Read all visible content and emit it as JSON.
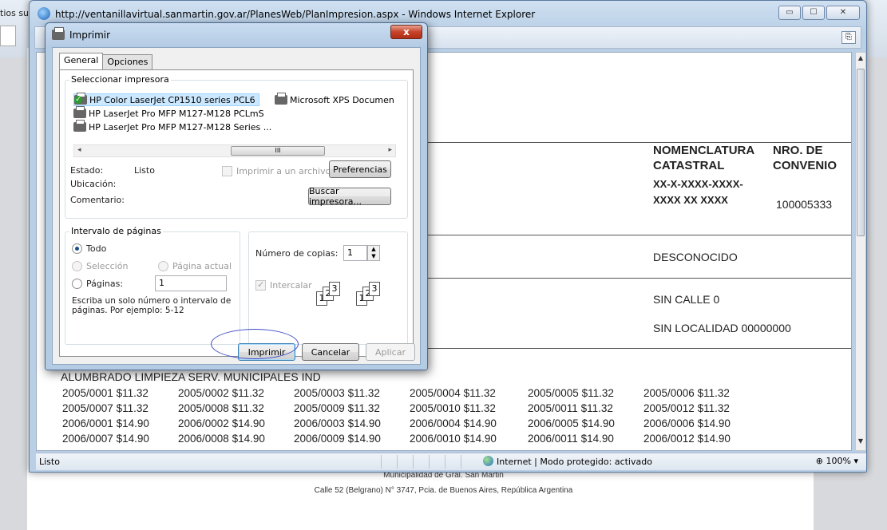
{
  "background": {
    "tab_fragment": "tios su",
    "footer_municipality": "Municipalidad de Gral. San Martin",
    "footer_address": "Calle 52 (Belgrano) N° 3747, Pcia. de Buenos Aires, República Argentina"
  },
  "browser": {
    "title": "http://ventanillavirtual.sanmartin.gov.ar/PlanesWeb/PlanImpresion.aspx - Windows Internet Explorer",
    "status_left": "Listo",
    "status_zone": "Internet | Modo protegido: activado",
    "zoom": "100%"
  },
  "document": {
    "col1_header": "NOMENCLATURA\nCATASTRAL",
    "col2_header": "NRO. DE\nCONVENIO",
    "nomenclatura": "XX-X-XXXX-XXXX-\nXXXX XX XXXX",
    "convenio": "100005333",
    "owner": "DESCONOCIDO",
    "street": "SIN CALLE 0",
    "locality": "SIN LOCALIDAD 00000000",
    "tax_title": "ALUMBRADO LIMPIEZA SERV. MUNICIPALES IND",
    "tax_rows": [
      [
        "2005/0001 $11.32",
        "2005/0002 $11.32",
        "2005/0003 $11.32",
        "2005/0004 $11.32",
        "2005/0005 $11.32",
        "2005/0006 $11.32"
      ],
      [
        "2005/0007 $11.32",
        "2005/0008 $11.32",
        "2005/0009 $11.32",
        "2005/0010 $11.32",
        "2005/0011 $11.32",
        "2005/0012 $11.32"
      ],
      [
        "2006/0001 $14.90",
        "2006/0002 $14.90",
        "2006/0003 $14.90",
        "2006/0004 $14.90",
        "2006/0005 $14.90",
        "2006/0006 $14.90"
      ],
      [
        "2006/0007 $14.90",
        "2006/0008 $14.90",
        "2006/0009 $14.90",
        "2006/0010 $14.90",
        "2006/0011 $14.90",
        "2006/0012 $14.90"
      ]
    ]
  },
  "print_dialog": {
    "title": "Imprimir",
    "close_label": "x",
    "tabs": [
      "General",
      "Opciones"
    ],
    "select_printer_label": "Seleccionar impresora",
    "printers": [
      "HP Color LaserJet CP1510 series PCL6",
      "Microsoft XPS Documen",
      "HP LaserJet Pro MFP M127-M128 PCLmS",
      "HP LaserJet Pro MFP M127-M128 Series ..."
    ],
    "scroll_thumb": "III",
    "estado_label": "Estado:",
    "estado_value": "Listo",
    "ubicacion_label": "Ubicación:",
    "comentario_label": "Comentario:",
    "print_to_file_label": "Imprimir a un archivo",
    "preferences_button": "Preferencias",
    "find_printer_button": "Buscar impresora...",
    "page_range_label": "Intervalo de páginas",
    "range_all": "Todo",
    "range_selection": "Selección",
    "range_current": "Página actual",
    "range_pages": "Páginas:",
    "pages_value": "1",
    "pages_hint": "Escriba un solo número o intervalo de\npáginas. Por ejemplo: 5-12",
    "copies_label": "Número de copias:",
    "copies_value": "1",
    "collate_label": "Intercalar",
    "print_button": "Imprimir",
    "cancel_button": "Cancelar",
    "apply_button": "Aplicar"
  }
}
